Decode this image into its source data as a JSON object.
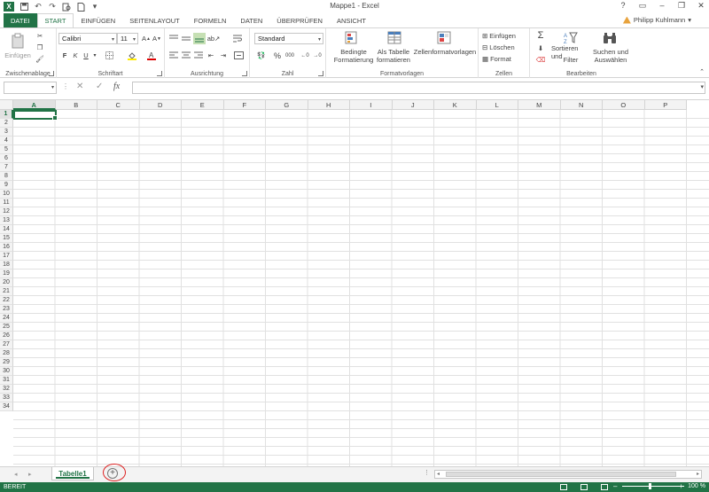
{
  "app": {
    "logo": "X",
    "title": "Mappe1 - Excel",
    "user": "Philipp Kuhlmann",
    "help": "?"
  },
  "tabs": [
    "DATEI",
    "START",
    "EINFÜGEN",
    "SEITENLAYOUT",
    "FORMELN",
    "DATEN",
    "ÜBERPRÜFEN",
    "ANSICHT"
  ],
  "ribbon": {
    "clipboard": {
      "label": "Zwischenablage",
      "paste": "Einfügen"
    },
    "font": {
      "label": "Schriftart",
      "name": "Calibri",
      "size": "11",
      "bold": "F",
      "italic": "K",
      "underline": "U"
    },
    "alignment": {
      "label": "Ausrichtung"
    },
    "number": {
      "label": "Zahl",
      "format": "Standard",
      "percent": "%",
      "thousands": "000"
    },
    "styles": {
      "label": "Formatvorlagen",
      "cond1": "Bedingte",
      "cond2": "Formatierung",
      "table1": "Als Tabelle",
      "table2": "formatieren",
      "cellstyles": "Zellenformatvorlagen"
    },
    "cells": {
      "label": "Zellen",
      "insert": "Einfügen",
      "delete": "Löschen",
      "format": "Format"
    },
    "editing": {
      "label": "Bearbeiten",
      "sort1": "Sortieren und",
      "sort2": "Filter",
      "find1": "Suchen und",
      "find2": "Auswählen"
    }
  },
  "formulabar": {
    "fx": "fx",
    "value": ""
  },
  "columns": [
    "A",
    "B",
    "C",
    "D",
    "E",
    "F",
    "G",
    "H",
    "I",
    "J",
    "K",
    "L",
    "M",
    "N",
    "O",
    "P"
  ],
  "rows": [
    "1",
    "2",
    "3",
    "4",
    "5",
    "6",
    "7",
    "8",
    "9",
    "10",
    "11",
    "12",
    "13",
    "14",
    "15",
    "16",
    "17",
    "18",
    "19",
    "20",
    "21",
    "22",
    "23",
    "24",
    "25",
    "26",
    "27",
    "28",
    "29",
    "30",
    "31",
    "32",
    "33",
    "34"
  ],
  "sheets": {
    "active": "Tabelle1",
    "add": "+"
  },
  "status": {
    "mode": "BEREIT",
    "zoom": "100 %"
  }
}
